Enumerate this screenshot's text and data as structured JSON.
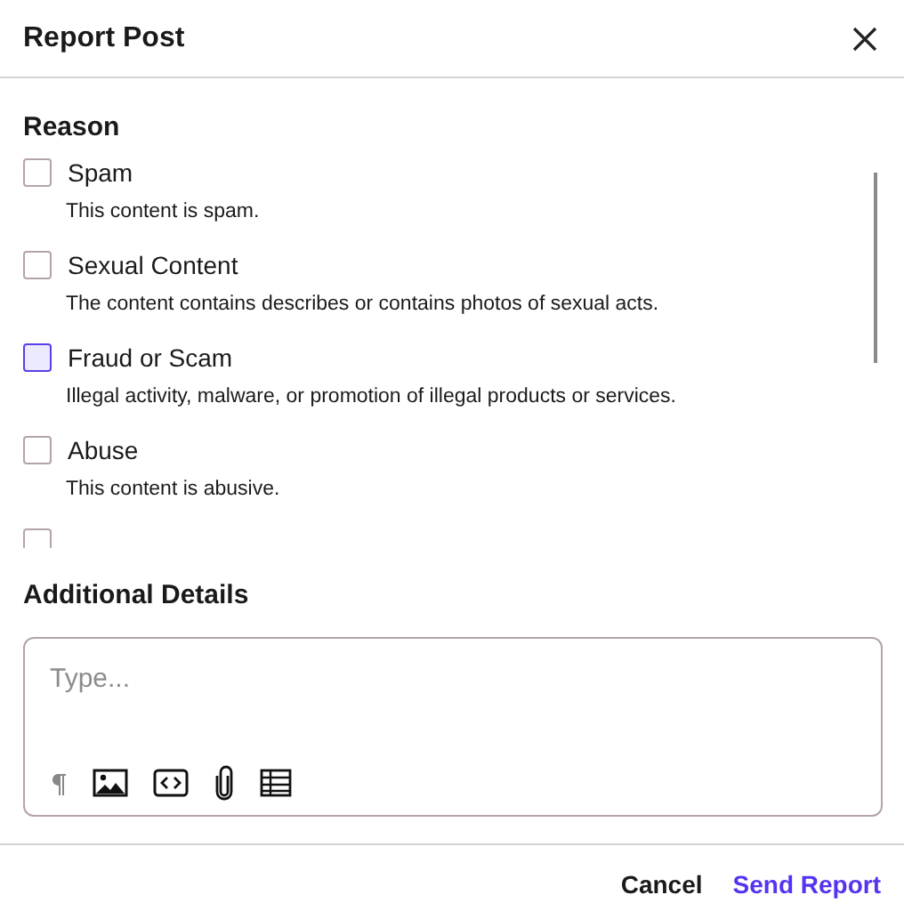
{
  "dialog": {
    "title": "Report Post"
  },
  "reason": {
    "heading": "Reason",
    "items": [
      {
        "label": "Spam",
        "description": "This content is spam.",
        "checked": false,
        "focused": false
      },
      {
        "label": "Sexual Content",
        "description": "The content contains describes or contains photos of sexual acts.",
        "checked": false,
        "focused": false
      },
      {
        "label": "Fraud or Scam",
        "description": "Illegal activity, malware, or promotion of illegal products or services.",
        "checked": false,
        "focused": true
      },
      {
        "label": "Abuse",
        "description": "This content is abusive.",
        "checked": false,
        "focused": false
      },
      {
        "checked": false,
        "focused": false
      }
    ]
  },
  "details": {
    "heading": "Additional Details",
    "placeholder": "Type..."
  },
  "buttons": [
    {
      "label": "Cancel",
      "kind": "secondary"
    },
    {
      "label": "Send Report",
      "kind": "primary"
    }
  ]
}
